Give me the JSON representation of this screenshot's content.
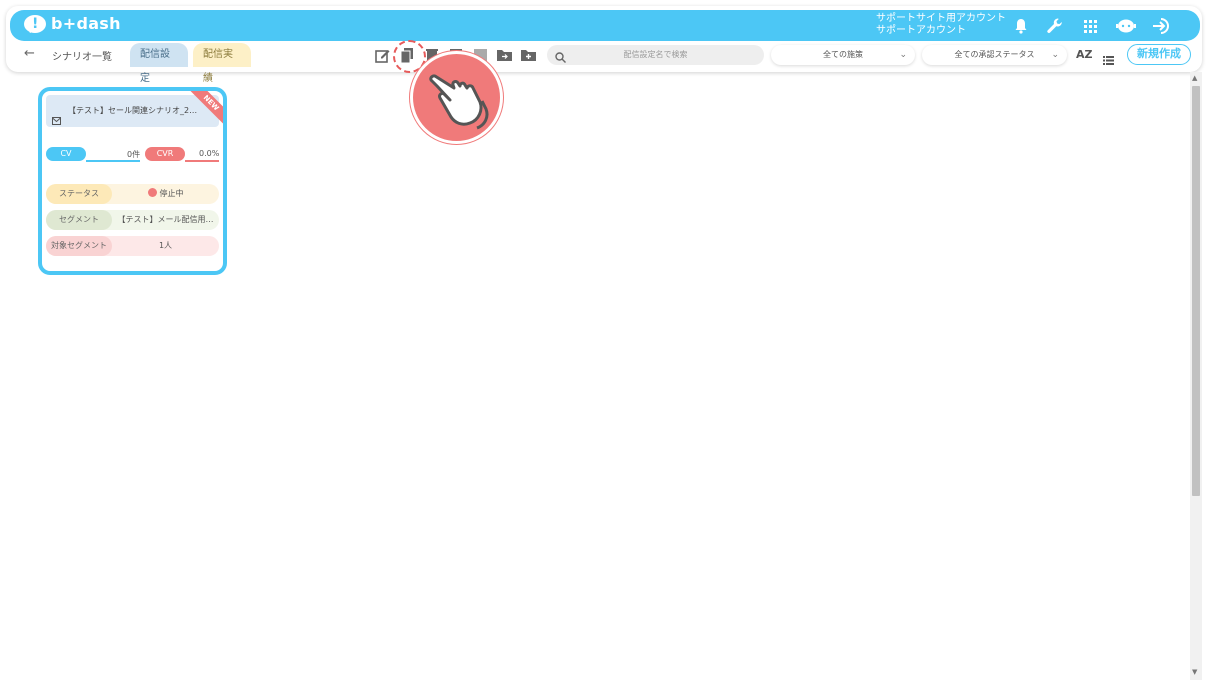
{
  "header": {
    "brand": "b+dash",
    "account_line1": "サポートサイト用アカウント",
    "account_line2": "サポートアカウント",
    "icons": [
      "bell-icon",
      "wrench-icon",
      "apps-grid-icon",
      "chat-bot-icon",
      "logout-icon"
    ]
  },
  "subbar": {
    "back_icon": "←",
    "breadcrumb": "シナリオ一覧",
    "tabs": [
      {
        "label": "配信設定",
        "active": true
      },
      {
        "label": "配信実績",
        "active": false
      }
    ],
    "tools": [
      "edit-icon",
      "copy-icon",
      "delete-icon",
      "stop-icon",
      "archive-icon",
      "move-folder-icon",
      "add-folder-icon"
    ],
    "search_placeholder": "配信設定名で検索",
    "filter_policy": "全ての施策",
    "filter_status": "全ての承認ステータス",
    "sort_label": "AZ",
    "new_button": "新規作成"
  },
  "card": {
    "badge": "NEW",
    "title": "【テスト】セール関連シナリオ_2…",
    "cv_label": "CV",
    "cv_value": "0件",
    "cvr_label": "CVR",
    "cvr_value": "0.0%",
    "rows": [
      {
        "label": "ステータス",
        "value": "停止中"
      },
      {
        "label": "セグメント",
        "value": "【テスト】メール配信用…"
      },
      {
        "label": "対象セグメント",
        "value": "1人"
      }
    ]
  },
  "colors": {
    "accent": "#4cc7f5",
    "alert": "#f07a7a"
  }
}
